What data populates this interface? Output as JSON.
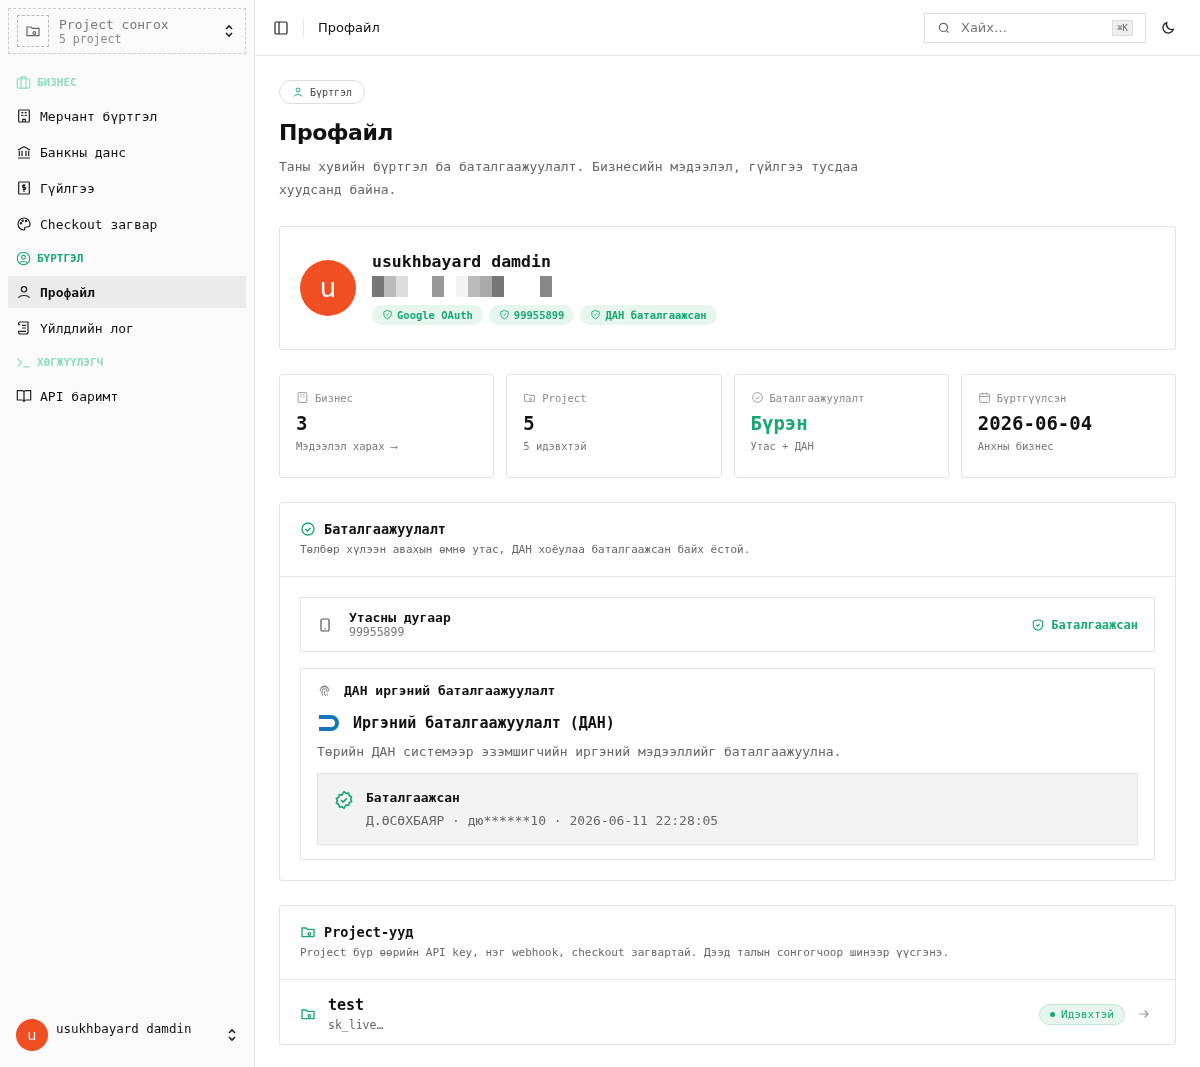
{
  "sidebar": {
    "project_picker": {
      "title": "Project сонгох",
      "subtitle": "5 project"
    },
    "nav": [
      {
        "kind": "section",
        "label": "БИЗНЕС",
        "muted": true
      },
      {
        "kind": "item",
        "label": "Мерчант бүртгэл",
        "selected": false
      },
      {
        "kind": "item",
        "label": "Банкны данс",
        "selected": false
      },
      {
        "kind": "item",
        "label": "Гүйлгээ",
        "selected": false
      },
      {
        "kind": "item",
        "label": "Checkout загвар",
        "selected": false
      },
      {
        "kind": "section",
        "label": "БҮРТГЭЛ",
        "muted": false
      },
      {
        "kind": "item",
        "label": "Профайл",
        "selected": true
      },
      {
        "kind": "item",
        "label": "Үйлдлийн лог",
        "selected": false
      },
      {
        "kind": "section",
        "label": "ХӨГЖҮҮЛЭГЧ",
        "muted": true
      },
      {
        "kind": "item",
        "label": "API баримт",
        "selected": false
      }
    ],
    "user": {
      "initial": "u",
      "name": "usukhbayard damdin"
    }
  },
  "topbar": {
    "title": "Профайл",
    "search": {
      "placeholder": "Хайх…",
      "shortcut": "⌘K"
    }
  },
  "page": {
    "badge": "Бүртгэл",
    "title": "Профайл",
    "description": "Таны хувийн бүртгэл ба баталгаажуулалт. Бизнесийн мэдээлэл, гүйлгээ тусдаа хуудсанд байна."
  },
  "profile": {
    "initial": "u",
    "name": "usukhbayard damdin",
    "tags": [
      "Google OAuth",
      "99955899",
      "ДАН баталгаажсан"
    ]
  },
  "stats": [
    {
      "label": "Бизнес",
      "value": "3",
      "note": "Мэдээлэл харах ⟶",
      "highlight": false
    },
    {
      "label": "Project",
      "value": "5",
      "note": "5 идэвхтэй",
      "highlight": false
    },
    {
      "label": "Баталгаажуулалт",
      "value": "Бүрэн",
      "note": "Утас + ДАН",
      "highlight": true
    },
    {
      "label": "Бүртгүүлсэн",
      "value": "2026-06-04",
      "note": "Анхны бизнес",
      "highlight": false
    }
  ],
  "verification": {
    "title": "Баталгаажуулалт",
    "description": "Төлбөр хүлээн авахын өмнө утас, ДАН хоёулаа баталгаажсан байх ёстой.",
    "phone": {
      "title": "Утасны дугаар",
      "value": "99955899",
      "status": "Баталгаажсан"
    },
    "dan": {
      "heading": "ДАН иргэний баталгаажуулалт",
      "title": "Иргэний баталгаажуулалт (ДАН)",
      "description": "Төрийн ДАН системээр эзэмшигчийн иргэний мэдээллийг баталгаажуулна.",
      "status": "Баталгаажсан",
      "details": "Д.ӨСӨХБАЯР · дю******10 · 2026-06-11 22:28:05"
    }
  },
  "projects": {
    "title": "Project-ууд",
    "description": "Project бүр өөрийн API key, нэг webhook, checkout загвартай. Дээд талын сонгогчоор шинээр үүсгэнэ.",
    "items": [
      {
        "name": "test",
        "key": "sk_live…",
        "status": "Идэвхтэй",
        "active": true
      }
    ]
  }
}
